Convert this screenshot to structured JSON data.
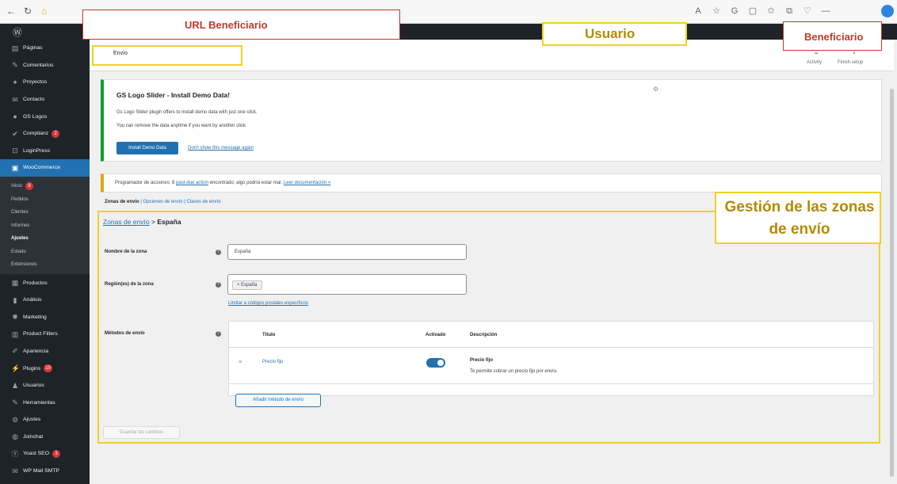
{
  "browser": {
    "icons": [
      "back-icon",
      "reload-icon",
      "home-icon"
    ]
  },
  "admin_bar": {
    "logo": "wordpress-icon"
  },
  "sidebar": {
    "items_top": [
      {
        "label": "Páginas",
        "icon": "pages-icon"
      },
      {
        "label": "Comentarios",
        "icon": "comments-icon"
      },
      {
        "label": "Proyectos",
        "icon": "projects-icon"
      },
      {
        "label": "Contacto",
        "icon": "contact-icon"
      },
      {
        "label": "GS Logos",
        "icon": "gs-logos-icon"
      },
      {
        "label": "Complianz",
        "icon": "complianz-icon",
        "badge": "2"
      },
      {
        "label": "LoginPress",
        "icon": "loginpress-icon"
      }
    ],
    "woocommerce": {
      "label": "WooCommerce",
      "icon": "woocommerce-icon"
    },
    "sub_items": [
      {
        "label": "Inicio",
        "badge": "8"
      },
      {
        "label": "Pedidos"
      },
      {
        "label": "Clientes"
      },
      {
        "label": "Informes"
      },
      {
        "label": "Ajustes",
        "current": true
      },
      {
        "label": "Estado"
      },
      {
        "label": "Extensiones"
      }
    ],
    "items_bottom": [
      {
        "label": "Productos",
        "icon": "products-icon"
      },
      {
        "label": "Análisis",
        "icon": "analytics-icon"
      },
      {
        "label": "Marketing",
        "icon": "marketing-icon"
      },
      {
        "label": "Product Filters",
        "icon": "filter-icon"
      },
      {
        "label": "Apariencia",
        "icon": "appearance-icon"
      },
      {
        "label": "Plugins",
        "icon": "plugins-icon",
        "badge": "10"
      },
      {
        "label": "Usuarios",
        "icon": "users-icon"
      },
      {
        "label": "Herramientas",
        "icon": "tools-icon"
      },
      {
        "label": "Ajustes",
        "icon": "settings-icon"
      },
      {
        "label": "Joinchat",
        "icon": "joinchat-icon"
      },
      {
        "label": "Yoast SEO",
        "icon": "yoast-icon",
        "badge": "3"
      },
      {
        "label": "WP Mail SMTP",
        "icon": "mail-icon"
      }
    ]
  },
  "header": {
    "title": "Envío",
    "activity": "Activity",
    "finish_setup": "Finish setup"
  },
  "notice": {
    "title": "GS Logo Slider - Install Demo Data!",
    "line1": "Gs Logo Slider plugin offers to install demo data with just one click.",
    "line2": "You can remove the data anytime if you want by another click.",
    "install_button": "Install Demo Data",
    "dismiss_link": "Don't show this message again"
  },
  "notice2": {
    "prefix": "Programador de acciones: 8",
    "link1": "past-due action",
    "middle": "encontrado; algo podría estar mal.",
    "link2": "Leer documentación »"
  },
  "subnav": {
    "current": "Zonas de envío",
    "others": "| Opciones de envío | Clases de envío"
  },
  "breadcrumb": {
    "link": "Zonas de envío",
    "sep": ">",
    "current": "España"
  },
  "form": {
    "zone_name_label": "Nombre de la zona",
    "zone_name_value": "España",
    "regions_label": "Región(es) de la zona",
    "regions_chip": "× España",
    "limit_link": "Limitar a códigos postales específicos",
    "methods_label": "Métodos de envío"
  },
  "methods_table": {
    "headers": [
      "Título",
      "Activado",
      "Descripción"
    ],
    "rows": [
      {
        "title": "Precio fijo",
        "enabled": true,
        "desc_title": "Precio fijo",
        "desc": "Te permite cobrar un precio fijo por envío."
      }
    ],
    "add_button": "Añadir método de envío"
  },
  "save_button": "Guardar los cambios",
  "annotations": {
    "url": "URL Beneficiario",
    "usuario": "Usuario",
    "beneficiario": "Beneficiario",
    "gestion": "Gestión de las zonas de envío"
  }
}
